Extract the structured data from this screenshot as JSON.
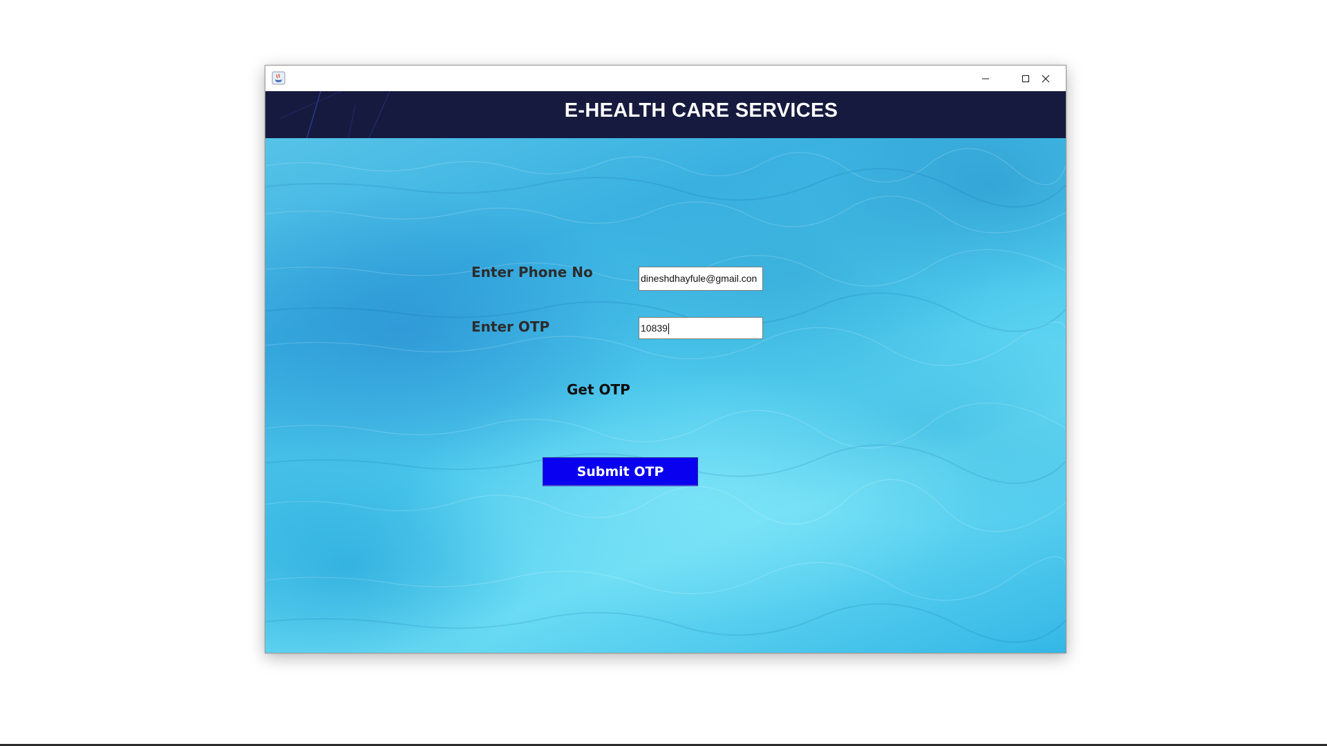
{
  "window": {
    "controls": {
      "minimize_icon": "minimize-icon",
      "maximize_icon": "maximize-icon",
      "close_icon": "close-icon"
    }
  },
  "header": {
    "title": "E-HEALTH CARE SERVICES",
    "background_color": "#161a3e"
  },
  "form": {
    "phone_label": "Enter Phone No",
    "phone_value": "dineshdhayfule@gmail.con",
    "otp_label": "Enter OTP",
    "otp_value": "10839",
    "get_otp_label": "Get OTP",
    "submit_label": "Submit OTP",
    "submit_color": "#0a00f0"
  },
  "navigation": {
    "back_icon": "arrow-left-icon"
  }
}
